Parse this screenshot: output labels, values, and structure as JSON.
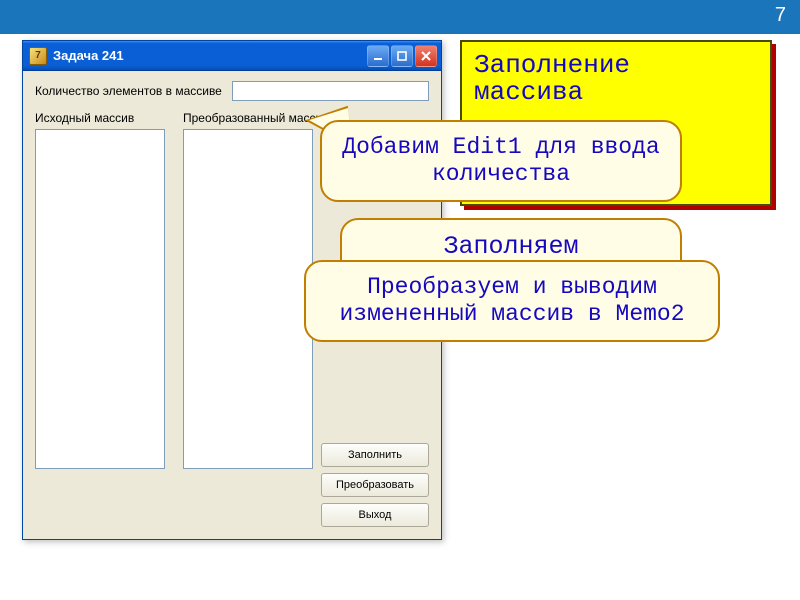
{
  "page_number": "7",
  "window": {
    "title": "Задача 241",
    "icon_label": "7",
    "label_count": "Количество элементов в массиве",
    "edit1_value": "",
    "label_memo1": "Исходный массив",
    "label_memo2": "Преобразованный массив",
    "buttons": {
      "fill": "Заполнить",
      "transform": "Преобразовать",
      "exit": "Выход"
    }
  },
  "note": {
    "line1": "Заполнение",
    "line2": "массива"
  },
  "bubbles": {
    "b1": "Добавим Edit1 для ввода количества",
    "b2": "Заполняем",
    "b3": "Преобразуем и выводим измененный массив в Memo2"
  }
}
